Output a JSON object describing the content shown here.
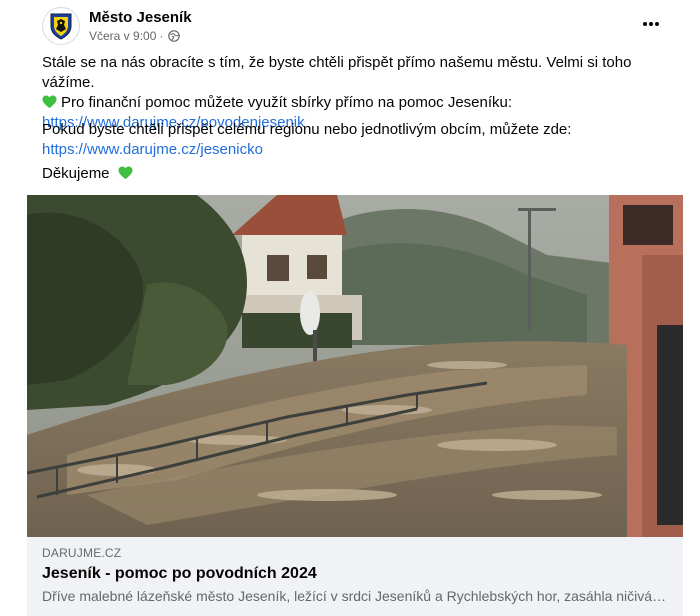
{
  "post": {
    "author": "Město Jeseník",
    "time": "Včera v 9:00",
    "separator": "·",
    "paragraph1_line1": "Stále se na nás obracíte s tím, že byste chtěli přispět přímo našemu městu. Velmi si toho vážíme.",
    "paragraph1_line2": "Pro finanční pomoc můžete využít sbírky přímo na pomoc Jeseníku:",
    "link1": "https://www.darujme.cz/povodenjesenik",
    "paragraph2": "Pokud byste chtěli přispět celému regionu nebo jednotlivým obcím, můžete zde:",
    "link2": "https://www.darujme.cz/jesenicko",
    "thanks": "Děkujeme"
  },
  "icons": {
    "more": "more-options-icon",
    "audience": "globe-icon",
    "heart": "green-heart-icon",
    "heart_color": "#3fbf3f"
  },
  "preview": {
    "domain": "DARUJME.CZ",
    "title": "Jeseník - pomoc po povodních 2024",
    "description": "Dříve malebné lázeňské město Jeseník, ležící v srdci Jeseníků a Rychlebských hor, zasáhla ničivá povodeň"
  },
  "colors": {
    "link": "#216fdb",
    "secondary_text": "#65676b",
    "preview_bg": "#f0f2f5"
  }
}
